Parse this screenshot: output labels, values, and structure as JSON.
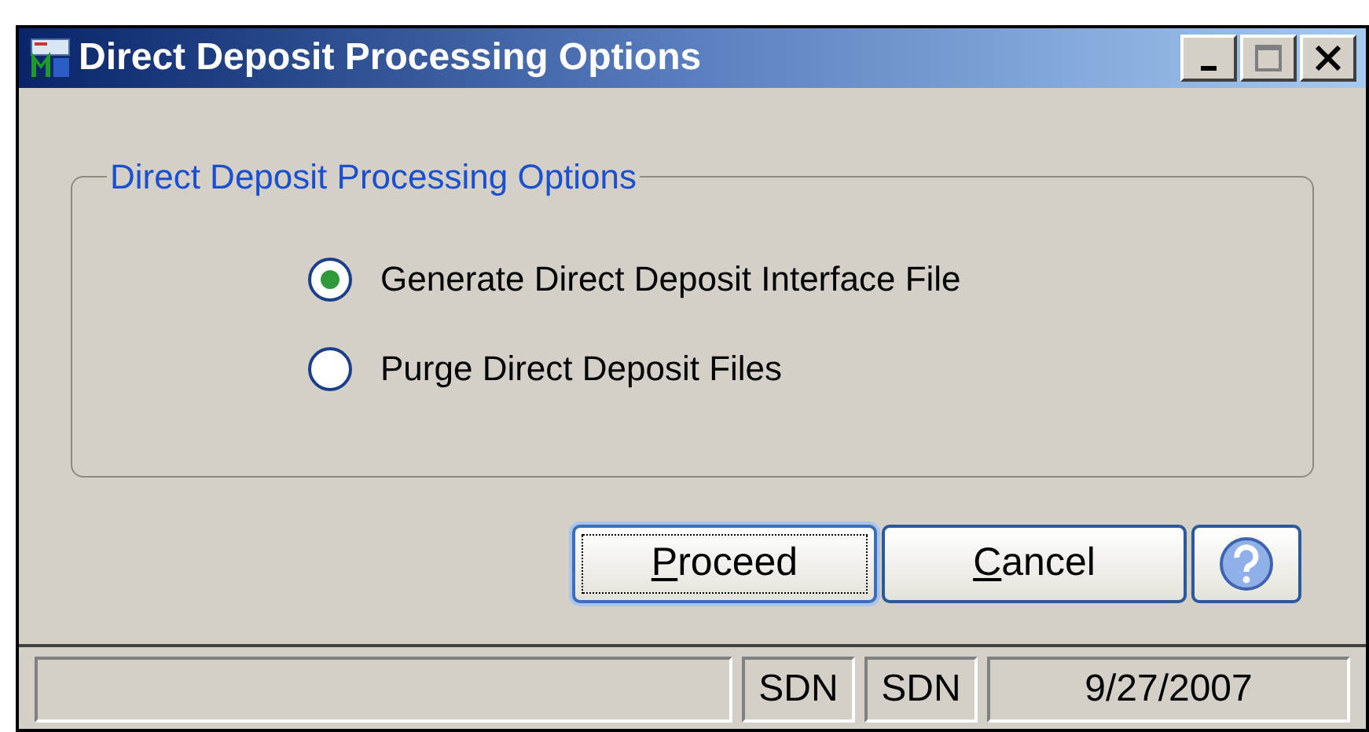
{
  "window": {
    "title": "Direct Deposit Processing Options"
  },
  "group": {
    "title": "Direct Deposit Processing Options",
    "options": [
      {
        "label": "Generate Direct Deposit Interface File",
        "selected": true
      },
      {
        "label": "Purge Direct Deposit Files",
        "selected": false
      }
    ]
  },
  "buttons": [
    {
      "kind": "text",
      "label": "Proceed",
      "focused": true
    },
    {
      "kind": "text",
      "label": "Cancel",
      "focused": false
    },
    {
      "kind": "help",
      "focused": false
    }
  ],
  "status_bar": [
    "SDN",
    "SDN",
    "9/27/2007"
  ]
}
